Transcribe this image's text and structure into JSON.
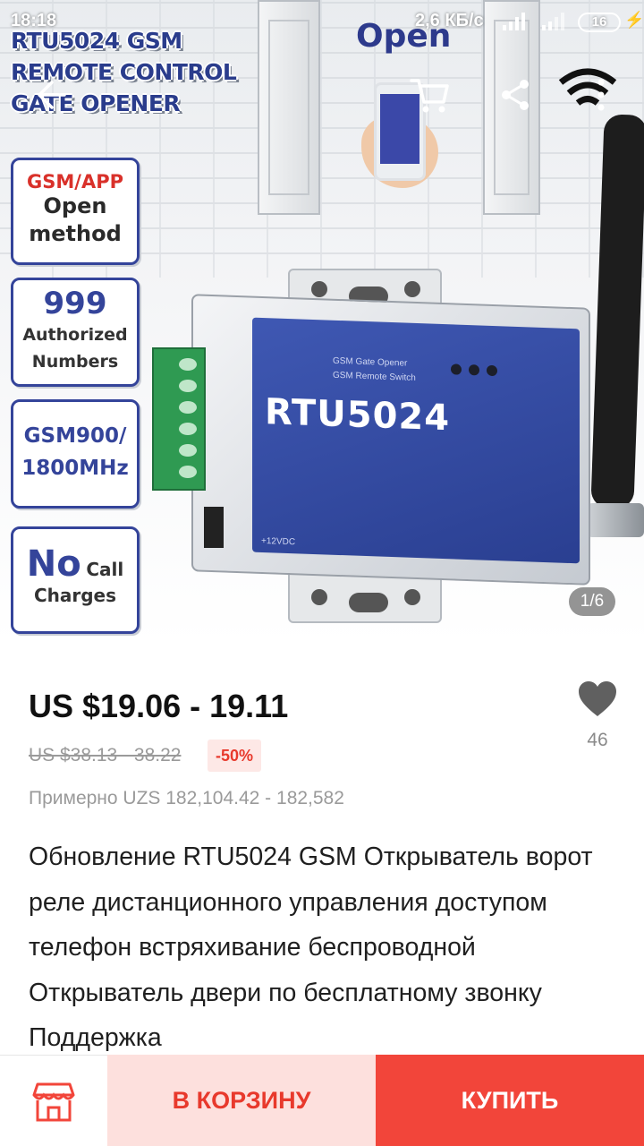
{
  "status_bar": {
    "time": "18:18",
    "speed": "2,6 КБ/с",
    "battery": "16"
  },
  "hero": {
    "banner_title": [
      "RTU5024 GSM",
      "REMOTE CONTROL",
      "GATE OPENER"
    ],
    "open_text": "Open",
    "features": {
      "f1": [
        "GSM/APP",
        "Open",
        "method"
      ],
      "f2": [
        "999",
        "Authorized",
        "Numbers"
      ],
      "f3": [
        "GSM900/",
        "1800MHz"
      ],
      "f4": [
        "No",
        "Call",
        "Charges"
      ]
    },
    "device_model": "RTU5024",
    "device_small_1": "GSM Gate Opener",
    "device_small_2": "GSM Remote Switch",
    "device_small_3": "+12VDC",
    "page_indicator": "1/6"
  },
  "product": {
    "price": "US $19.06 - 19.11",
    "old_price": "US $38.13 - 38.22",
    "discount": "-50%",
    "approx": "Примерно UZS 182,104.42 - 182,582",
    "wishlist_count": "46",
    "title": "Обновление RTU5024 GSM Открыватель ворот реле дистанционного управления доступом телефон встряхивание беспроводной Открыватель двери по бесплатному звонку Поддержка"
  },
  "bottom_bar": {
    "add_to_cart": "В КОРЗИНУ",
    "buy": "КУПИТЬ"
  },
  "icons": {
    "back": "arrow-left-icon",
    "cart": "shopping-cart-icon",
    "share": "share-icon",
    "more": "more-vertical-icon",
    "wishlist": "heart-icon",
    "store": "store-icon"
  },
  "colors": {
    "accent": "#f2453a",
    "accent_light": "#fde0dd",
    "price": "#111111",
    "muted": "#9a9a9a"
  }
}
